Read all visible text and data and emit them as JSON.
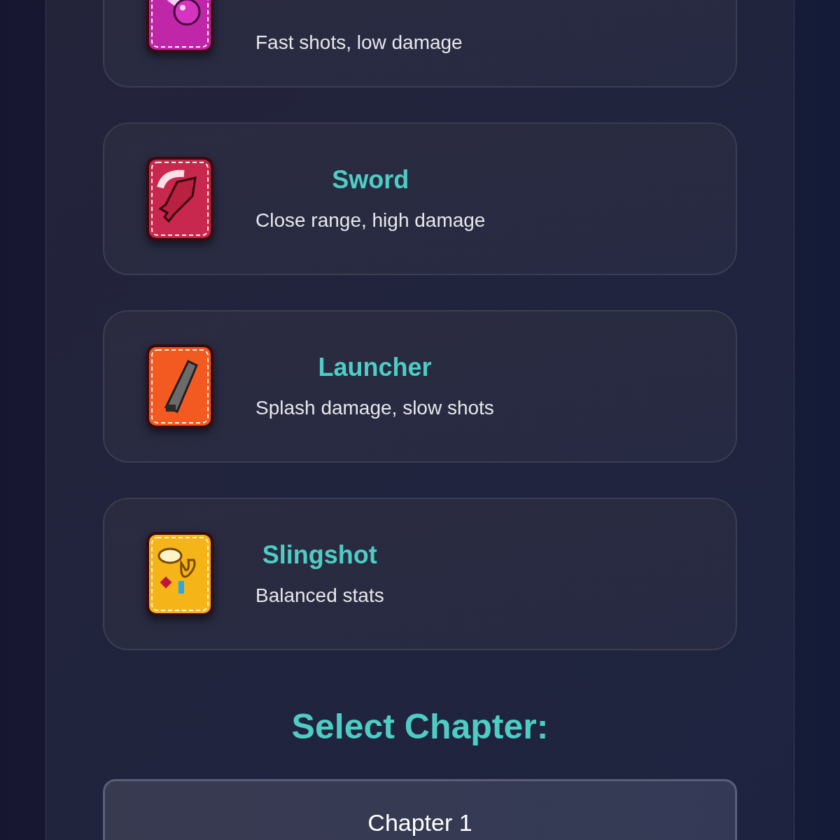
{
  "weapons": [
    {
      "kind": "orb",
      "color": "#c026a8",
      "description": "Fast shots, low damage"
    },
    {
      "kind": "sword",
      "color": "#c8284e",
      "title": "Sword",
      "description": "Close range, high damage"
    },
    {
      "kind": "launcher",
      "color": "#f25a22",
      "title": "Launcher",
      "description": "Splash damage, slow shots"
    },
    {
      "kind": "slingshot",
      "color": "#f5b418",
      "title": "Slingshot",
      "description": "Balanced stats"
    }
  ],
  "chapter_heading": "Select Chapter:",
  "chapters": [
    {
      "label": "Chapter 1"
    }
  ]
}
